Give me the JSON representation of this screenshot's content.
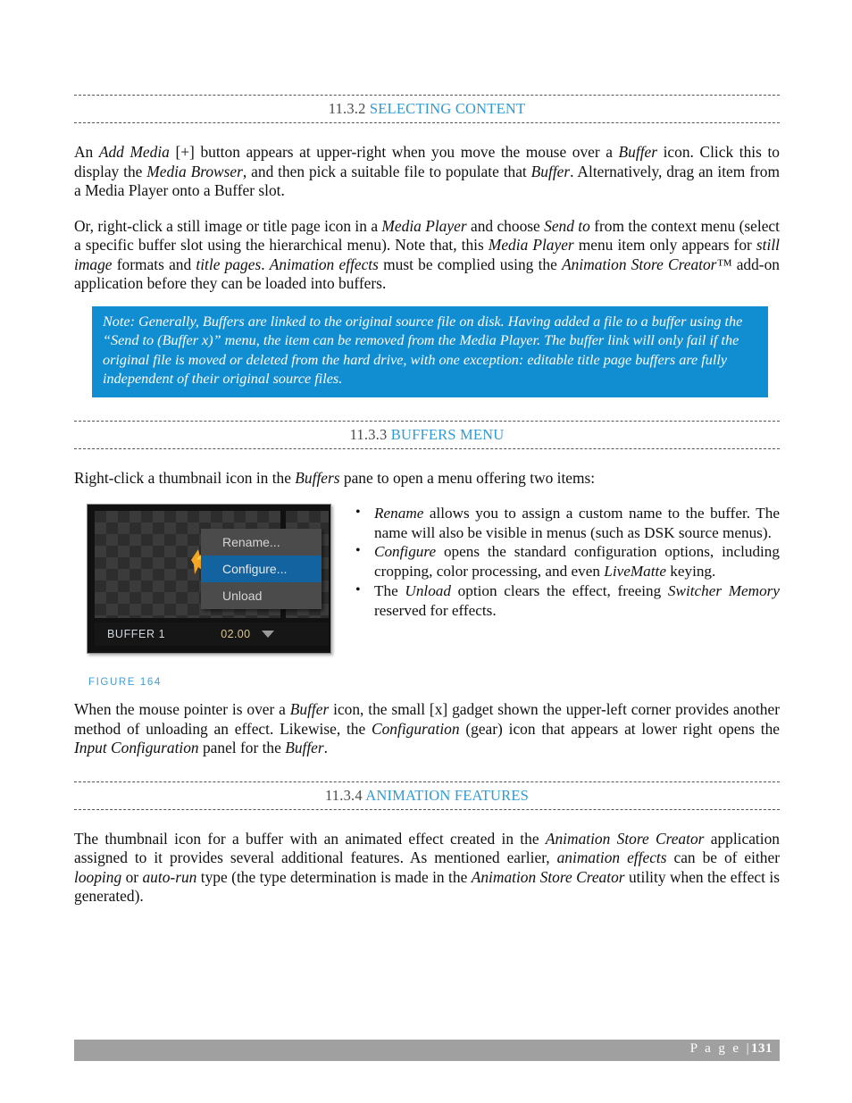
{
  "document": {
    "page_number": "131",
    "footer_label": "P a g e  |",
    "footer_full": "P a g e | 131"
  },
  "sections": {
    "selecting_content": {
      "number": "11.3.2",
      "title": "SELECTING CONTENT",
      "paragraph_1_html": "An <em>Add Media</em> [+] button appears at upper-right when you move the mouse over a <em>Buffer</em> icon.  Click this to display the <em>Media Browser</em>, and then pick a suitable file to populate that <em>Buffer</em>.  Alternatively, drag an item from a Media Player onto a Buffer slot.",
      "paragraph_2_html": "Or, right-click a still image or title page icon in a <em>Media Player</em> and choose <em>Send to</em> from the context menu (select a specific buffer slot using the hierarchical menu).  Note that, this <em>Media Player</em> menu item only appears for <em>still image</em> formats and <em>title pages</em>.  <em>Animation effects</em> must be complied using the <em>Animation Store Creator™</em> add-on application before they can be loaded into buffers.",
      "note_html": "Note: Generally, Buffers are linked to the original source file on disk.  Having added a file to a buffer using the “Send to (Buffer x)” menu, the item can be removed from the Media Player. The buffer link will only fail if the original file is moved or deleted from the hard drive, with one exception: editable title page buffers are fully independent of their original source files."
    },
    "buffers_menu": {
      "number": "11.3.3",
      "title": "BUFFERS MENU",
      "intro_html": "Right-click a thumbnail icon in the <em>Buffers</em> pane to open a menu offering two items:",
      "bullets_html": [
        "<em>Rename</em> allows you to assign a custom name to the buffer.  The name will also be visible in menus (such as DSK source menus).",
        "<em>Configure</em> opens the standard configuration options, including cropping, color processing, and even <em>LiveMatte</em> keying.",
        "The <em>Unload</em> option clears the effect, freeing <em>Switcher Memory</em> reserved for effects."
      ],
      "figure": {
        "caption": "FIGURE 164",
        "context_menu_items": [
          {
            "label": "Rename...",
            "selected": false
          },
          {
            "label": "Configure...",
            "selected": true
          },
          {
            "label": "Unload",
            "selected": false
          }
        ],
        "buffer_name": "BUFFER 1",
        "buffer_time": "02.00",
        "dropdown_icon": "chevron-down-icon",
        "thumbnail_icon": "star-spark-icon"
      },
      "paragraph_after_html": "When the mouse pointer is over a <em>Buffer</em> icon, the small [x] gadget shown the upper-left corner provides another method of unloading an effect.  Likewise, the <em>Configuration</em> (gear) icon that appears at lower right opens the <em>Input Configuration</em> panel for the <em>Buffer</em>."
    },
    "animation_features": {
      "number": "11.3.4",
      "title": "ANIMATION FEATURES",
      "paragraph_html": "The thumbnail icon for a buffer with an animated effect created in the <em>Animation Store Creator</em> application assigned to it provides several additional features.  As mentioned earlier, <em>animation effects</em> can be of either <em>looping</em> or <em>auto-run</em> type (the type determination is made in the <em>Animation Store Creator</em> utility when the effect is generated)."
    }
  },
  "colors": {
    "heading_title": "#2e9bd6",
    "heading_number": "#4a4a4a",
    "note_background": "#118dd2",
    "caption": "#3e9fd6",
    "footer_bar": "#a0a0a0",
    "menu_highlight": "#12639f"
  }
}
